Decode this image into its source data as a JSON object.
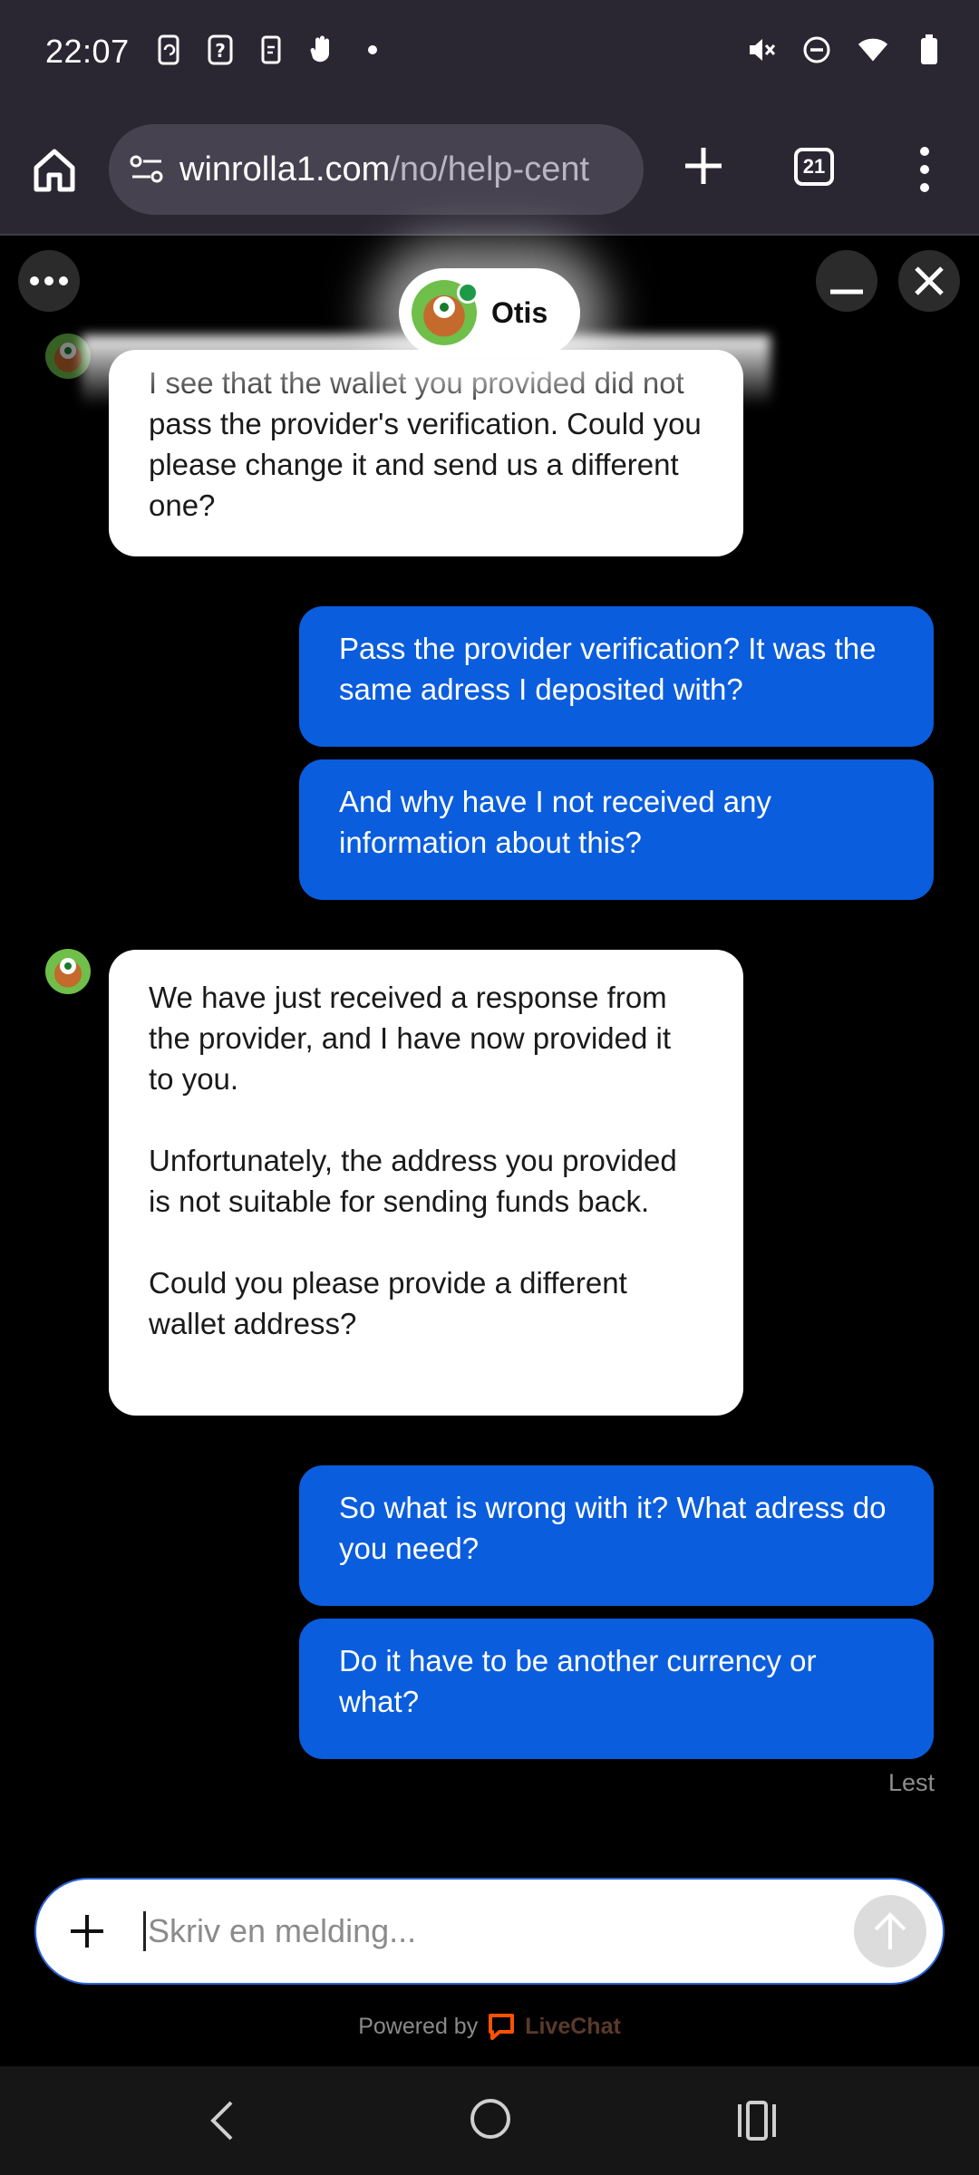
{
  "status_bar": {
    "time": "22:07",
    "left_icons": [
      "phone-sync-icon",
      "question-box-icon",
      "clipboard-icon",
      "hand-icon",
      "dot-icon"
    ],
    "right_icons": [
      "vibrate-off-icon",
      "do-not-disturb-icon",
      "wifi-icon",
      "battery-icon"
    ]
  },
  "browser": {
    "url_domain": "winrolla1.com",
    "url_path": "/no/help-cent",
    "tab_count": "21"
  },
  "chat": {
    "agent_name": "Otis",
    "messages": [
      {
        "from": "agent",
        "text": "I see that the wallet you provided did not pass the provider's verification. Could you please change it and send us a different one?"
      },
      {
        "from": "user",
        "text": "Pass the provider verification? It was the same adress I deposited with?"
      },
      {
        "from": "user",
        "text": "And why have I not received any information about this?"
      },
      {
        "from": "agent",
        "text": "We have just received a response from the provider, and I have now provided it to you.\n\nUnfortunately, the address you provided is not suitable for sending funds back.\n\nCould you please provide a different wallet address?"
      },
      {
        "from": "user",
        "text": "So what is wrong with it? What adress do you need?"
      },
      {
        "from": "user",
        "text": "Do it have to be another currency or what?"
      }
    ],
    "read_status": "Lest",
    "composer_placeholder": "Skriv en melding...",
    "powered_by": "Powered by",
    "brand": "LiveChat"
  },
  "colors": {
    "user_bubble": "#0a5ddd",
    "agent_bubble": "#ffffff",
    "background": "#000000",
    "livechat_orange": "#ff5100"
  }
}
